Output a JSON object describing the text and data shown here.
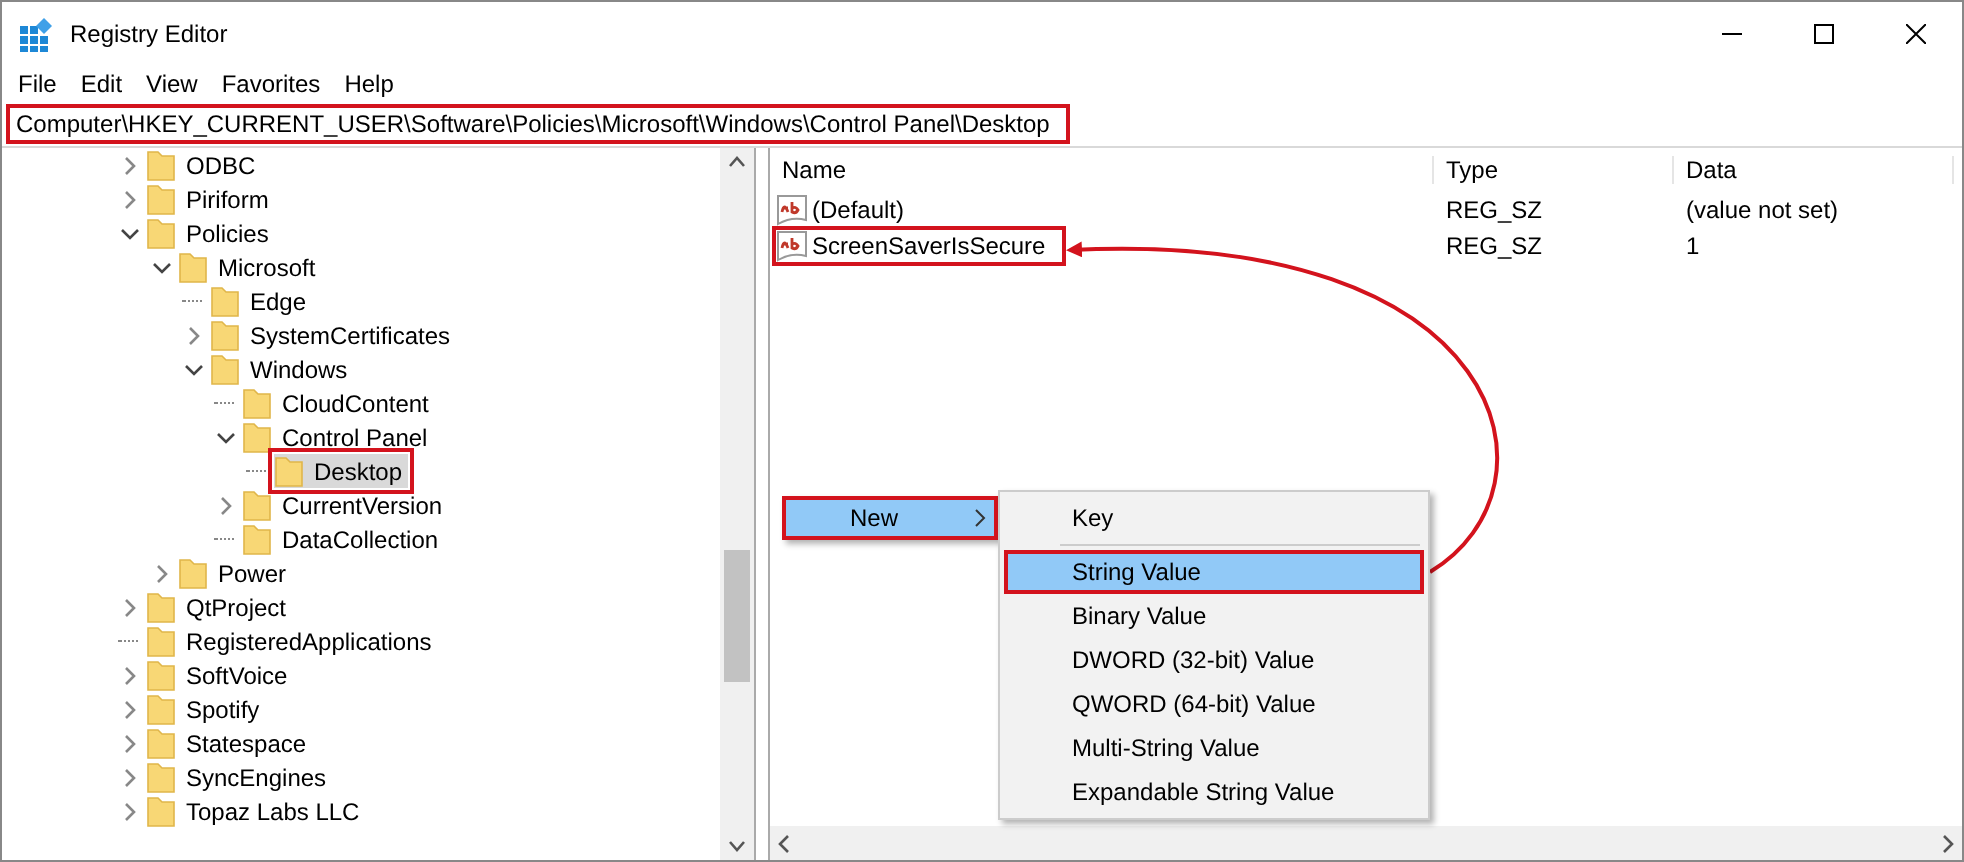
{
  "window": {
    "title": "Registry Editor"
  },
  "menu_bar": [
    "File",
    "Edit",
    "View",
    "Favorites",
    "Help"
  ],
  "address_bar": {
    "value": "Computer\\HKEY_CURRENT_USER\\Software\\Policies\\Microsoft\\Windows\\Control Panel\\Desktop",
    "annotated": true
  },
  "tree": {
    "items": [
      {
        "label": "ODBC",
        "kind": "branch",
        "expanded": false,
        "selected": false,
        "annotated": false
      },
      {
        "label": "Piriform",
        "kind": "branch",
        "expanded": false,
        "selected": false,
        "annotated": false
      },
      {
        "label": "Policies",
        "kind": "branch",
        "expanded": true,
        "selected": false,
        "annotated": false,
        "children": [
          {
            "label": "Microsoft",
            "kind": "branch",
            "expanded": true,
            "selected": false,
            "annotated": false,
            "children": [
              {
                "label": "Edge",
                "kind": "leaf",
                "selected": false,
                "annotated": false
              },
              {
                "label": "SystemCertificates",
                "kind": "branch",
                "expanded": false,
                "selected": false,
                "annotated": false
              },
              {
                "label": "Windows",
                "kind": "branch",
                "expanded": true,
                "selected": false,
                "annotated": false,
                "children": [
                  {
                    "label": "CloudContent",
                    "kind": "leaf",
                    "selected": false,
                    "annotated": false
                  },
                  {
                    "label": "Control Panel",
                    "kind": "branch",
                    "expanded": true,
                    "selected": false,
                    "annotated": false,
                    "children": [
                      {
                        "label": "Desktop",
                        "kind": "leaf",
                        "selected": true,
                        "annotated": true
                      }
                    ]
                  },
                  {
                    "label": "CurrentVersion",
                    "kind": "branch",
                    "expanded": false,
                    "selected": false,
                    "annotated": false
                  },
                  {
                    "label": "DataCollection",
                    "kind": "leaf",
                    "selected": false,
                    "annotated": false
                  }
                ]
              }
            ]
          },
          {
            "label": "Power",
            "kind": "branch",
            "expanded": false,
            "selected": false,
            "annotated": false
          }
        ]
      },
      {
        "label": "QtProject",
        "kind": "branch",
        "expanded": false,
        "selected": false,
        "annotated": false
      },
      {
        "label": "RegisteredApplications",
        "kind": "leaf",
        "selected": false,
        "annotated": false
      },
      {
        "label": "SoftVoice",
        "kind": "branch",
        "expanded": false,
        "selected": false,
        "annotated": false
      },
      {
        "label": "Spotify",
        "kind": "branch",
        "expanded": false,
        "selected": false,
        "annotated": false
      },
      {
        "label": "Statespace",
        "kind": "branch",
        "expanded": false,
        "selected": false,
        "annotated": false
      },
      {
        "label": "SyncEngines",
        "kind": "branch",
        "expanded": false,
        "selected": false,
        "annotated": false
      },
      {
        "label": "Topaz Labs LLC",
        "kind": "branch",
        "expanded": false,
        "selected": false,
        "annotated": false
      }
    ]
  },
  "values": {
    "columns": [
      "Name",
      "Type",
      "Data"
    ],
    "rows": [
      {
        "name": "(Default)",
        "type": "REG_SZ",
        "data": "(value not set)",
        "annotated": false
      },
      {
        "name": "ScreenSaverIsSecure",
        "type": "REG_SZ",
        "data": "1",
        "annotated": true
      }
    ]
  },
  "context_menu": {
    "items": [
      {
        "label": "New",
        "selected": true,
        "annotated": true
      }
    ]
  },
  "submenu": {
    "items": [
      {
        "label": "Key",
        "selected": false,
        "annotated": false,
        "separator_after": true
      },
      {
        "label": "String Value",
        "selected": true,
        "annotated": true,
        "separator_after": false
      },
      {
        "label": "Binary Value",
        "selected": false,
        "annotated": false,
        "separator_after": false
      },
      {
        "label": "DWORD (32-bit) Value",
        "selected": false,
        "annotated": false,
        "separator_after": false
      },
      {
        "label": "QWORD (64-bit) Value",
        "selected": false,
        "annotated": false,
        "separator_after": false
      },
      {
        "label": "Multi-String Value",
        "selected": false,
        "annotated": false,
        "separator_after": false
      },
      {
        "label": "Expandable String Value",
        "selected": false,
        "annotated": false,
        "separator_after": false
      }
    ]
  }
}
